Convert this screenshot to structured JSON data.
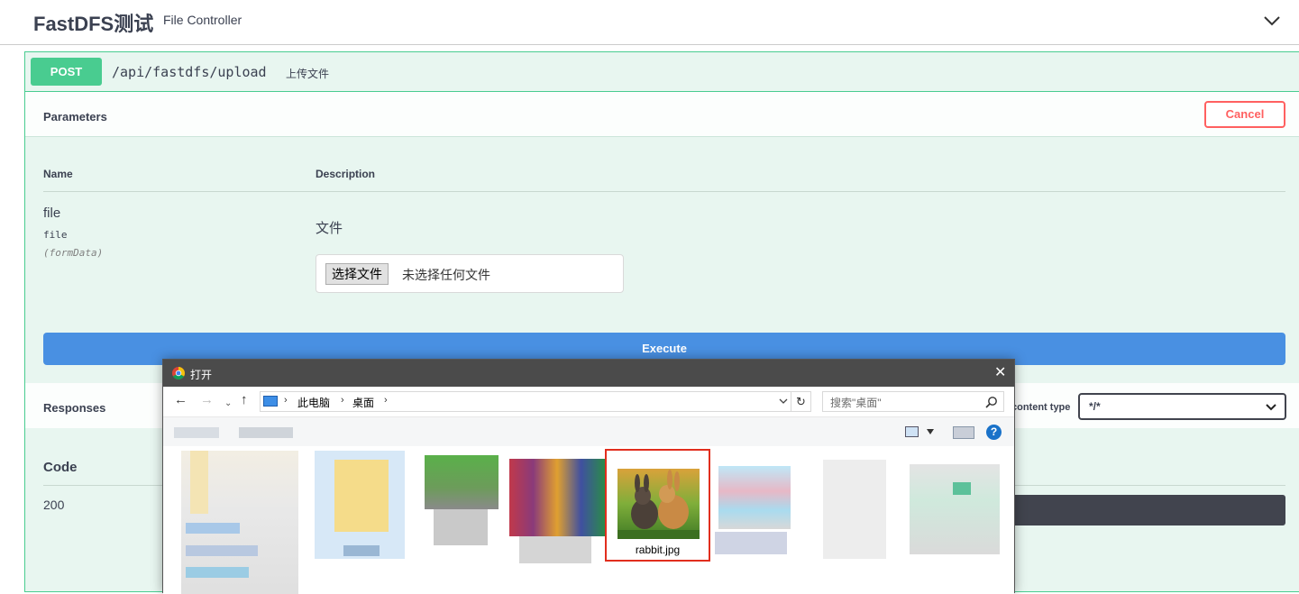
{
  "header": {
    "tag_title": "FastDFS测试",
    "tag_description": "File Controller",
    "collapse_icon": "chevron-down-icon"
  },
  "operation": {
    "method": "POST",
    "path": "/api/fastdfs/upload",
    "summary": "上传文件",
    "parameters_title": "Parameters",
    "cancel_label": "Cancel",
    "columns": {
      "name": "Name",
      "description": "Description"
    },
    "param": {
      "name": "file",
      "type": "file",
      "in": "(formData)",
      "description": "文件",
      "file_button": "选择文件",
      "file_status": "未选择任何文件"
    },
    "execute_label": "Execute",
    "responses_title": "Responses",
    "content_type_label": "content type",
    "content_type_value": "*/*",
    "code_header": "Code",
    "code_value": "200"
  },
  "dialog": {
    "title": "打开",
    "breadcrumbs": [
      "此电脑",
      "桌面"
    ],
    "search_placeholder": "搜索\"桌面\"",
    "selected_file": "rabbit.jpg",
    "colors": {
      "selection_border": "#e12e1e",
      "titlebar": "#4b4b4b"
    }
  },
  "colors": {
    "post": "#49cc90",
    "execute": "#4990e2",
    "cancel": "#ff6060",
    "opblock_bg": "#e8f6f0"
  }
}
